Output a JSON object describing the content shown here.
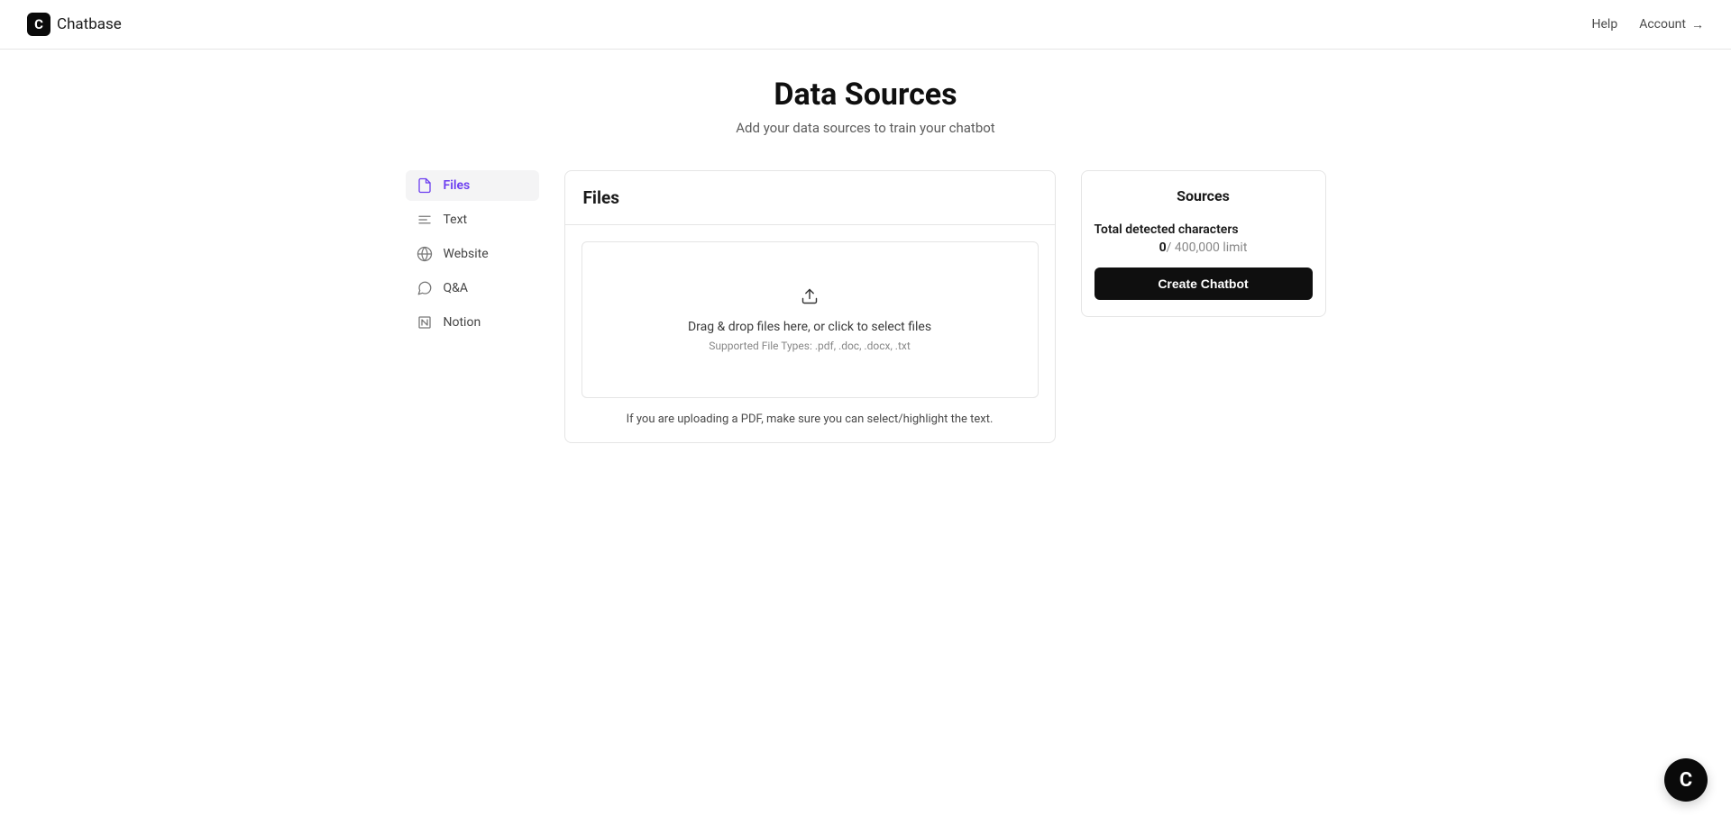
{
  "header": {
    "brand": "Chatbase",
    "help": "Help",
    "account": "Account"
  },
  "page": {
    "title": "Data Sources",
    "subtitle": "Add your data sources to train your chatbot"
  },
  "sidebar": {
    "items": [
      {
        "label": "Files"
      },
      {
        "label": "Text"
      },
      {
        "label": "Website"
      },
      {
        "label": "Q&A"
      },
      {
        "label": "Notion"
      }
    ]
  },
  "main": {
    "card_title": "Files",
    "dropzone_text": "Drag & drop files here, or click to select files",
    "dropzone_subtext": "Supported File Types: .pdf, .doc, .docx, .txt",
    "helper": "If you are uploading a PDF, make sure you can select/highlight the text."
  },
  "sources": {
    "title": "Sources",
    "char_label": "Total detected characters",
    "char_count": "0",
    "char_limit": "/ 400,000 limit",
    "create_button": "Create Chatbot"
  }
}
